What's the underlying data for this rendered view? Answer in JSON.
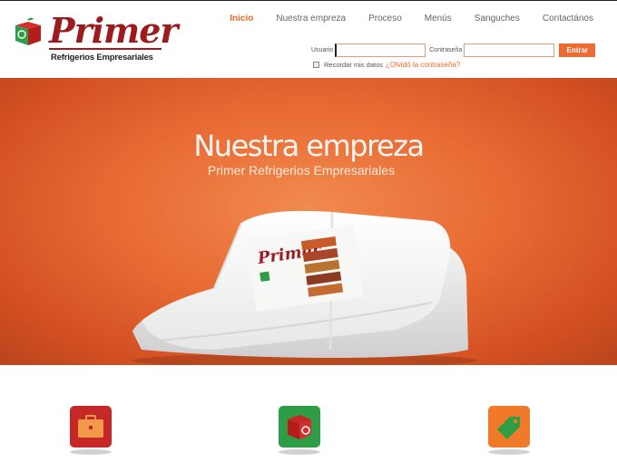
{
  "brand": {
    "name": "Primer",
    "tagline": "Refrigerios Empresariales",
    "color": "#9c1b1e"
  },
  "nav": {
    "items": [
      {
        "label": "Inicio",
        "active": true
      },
      {
        "label": "Nuestra empreza",
        "active": false
      },
      {
        "label": "Proceso",
        "active": false
      },
      {
        "label": "Menús",
        "active": false
      },
      {
        "label": "Sanguches",
        "active": false
      },
      {
        "label": "Contactános",
        "active": false
      }
    ]
  },
  "login": {
    "user_label": "Usuario",
    "user_value": "",
    "pass_label": "Contraseña",
    "pass_value": "",
    "submit_label": "Entrar",
    "remember_label": "Recordar mis datos",
    "forgot_label": "¿Olvidó la contraseña?"
  },
  "hero": {
    "title": "Nuestra empreza",
    "subtitle": "Primer Refrigerios Empresariales"
  },
  "features": [
    {
      "icon": "briefcase-icon",
      "color": "#c62828"
    },
    {
      "icon": "recycle-box-icon",
      "color": "#2e9d45"
    },
    {
      "icon": "tag-icon",
      "color": "#f07a2a"
    }
  ],
  "colors": {
    "accent": "#ef6a2a",
    "hero_bg": "#e86a33"
  }
}
